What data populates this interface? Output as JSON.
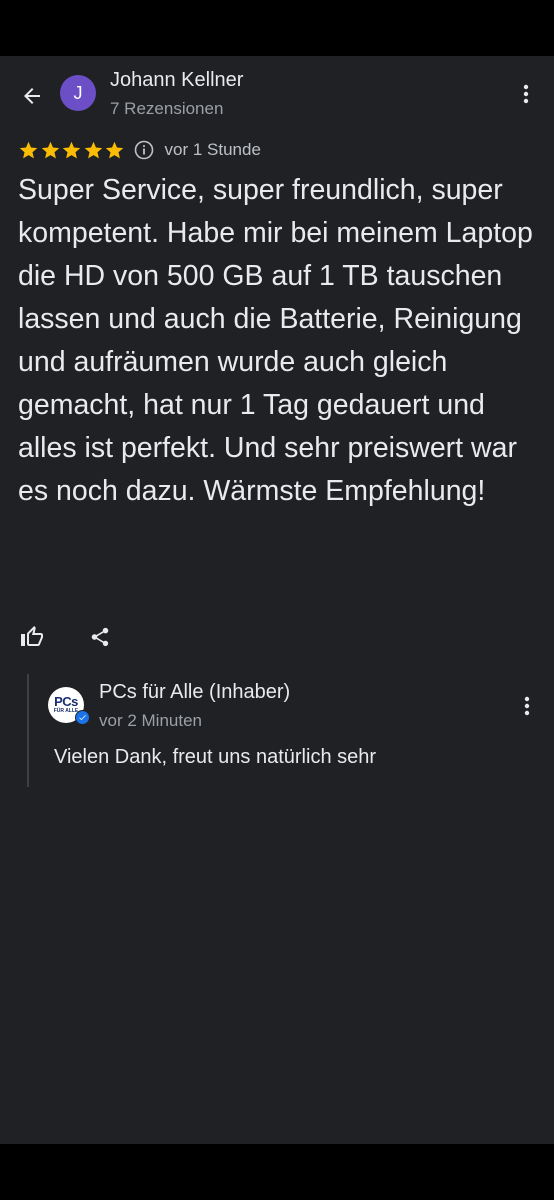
{
  "review": {
    "author": {
      "initial": "J",
      "name": "Johann Kellner",
      "review_count": "7 Rezensionen",
      "avatar_color": "#6c4fc7"
    },
    "rating": 5,
    "star_color": "#fbbc04",
    "time_ago": "vor 1 Stunde",
    "text": "Super Service, super freundlich, super kompetent. Habe mir bei meinem Laptop die HD von 500 GB auf 1 TB tauschen lassen und auch die Batterie, Reinigung und aufräumen wurde auch gleich gemacht, hat nur 1 Tag gedauert und alles ist perfekt. Und sehr preiswert war es noch dazu. Wärmste Empfehlung!",
    "actions": {
      "like_icon": "thumb-up-outline-icon",
      "share_icon": "share-icon"
    }
  },
  "owner_reply": {
    "logo_main": "PCs",
    "logo_sub": "FÜR ALLE",
    "name": "PCs für Alle (Inhaber)",
    "time_ago": "vor 2 Minuten",
    "text": "Vielen Dank, freut uns natürlich sehr",
    "verified_color": "#1a73e8"
  },
  "theme": {
    "background": "#202124",
    "text_primary": "#e8eaed",
    "text_secondary": "#9aa0a6"
  }
}
